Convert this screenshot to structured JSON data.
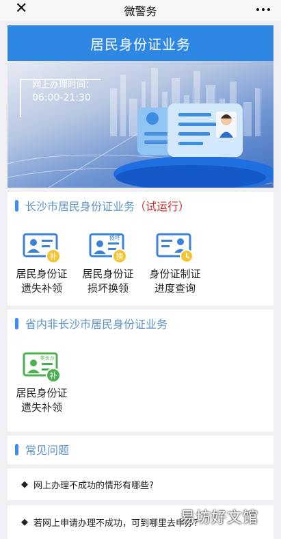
{
  "topbar": {
    "title": "微警务",
    "close_glyph": "✕",
    "more_icon": "more-dots-icon"
  },
  "hero": {
    "title": "居民身份证业务"
  },
  "banner": {
    "hours_label": "网上办理时间：",
    "hours_value": "06:00-21:30"
  },
  "section1": {
    "title": "长沙市居民身份证业务",
    "tag": "（试运行）",
    "tiles": [
      {
        "line1": "居民身份证",
        "line2": "遗失补领",
        "badge": "补",
        "icon": "id-card-replace-icon"
      },
      {
        "line1": "居民身份证",
        "line2": "损坏换领",
        "badge": "换",
        "corner": "损坏",
        "icon": "id-card-exchange-icon"
      },
      {
        "line1": "身份证制证",
        "line2": "进度查询",
        "icon": "id-card-progress-icon"
      }
    ]
  },
  "section2": {
    "title": "省内非长沙市居民身份证业务",
    "tiles": [
      {
        "line1": "居民身份证",
        "line2": "遗失补领",
        "badge": "补",
        "corner": "非长沙",
        "icon": "id-card-replace-green-icon"
      }
    ]
  },
  "faq": {
    "title": "常见问题",
    "items": [
      {
        "text": "网上办理不成功的情形有哪些?"
      },
      {
        "text": "若网上申请办理不成功，可到哪里去申办?"
      }
    ]
  },
  "watermark": {
    "text": "易坊好文馆"
  },
  "colors": {
    "primary": "#2f87e4",
    "section_title": "#5d93c9",
    "tag_red": "#c9302c",
    "green": "#4caf50"
  }
}
